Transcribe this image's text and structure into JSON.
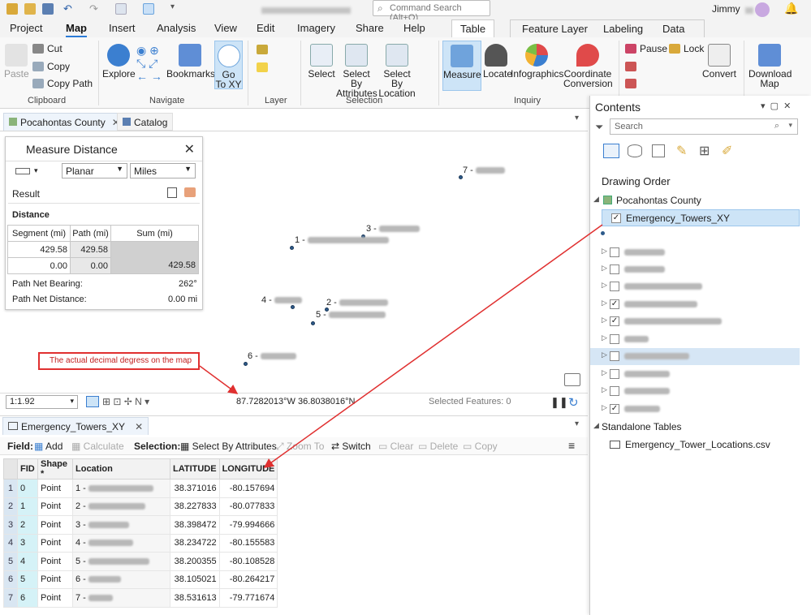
{
  "qat": {
    "search_placeholder": "Command Search (Alt+Q)",
    "user": "Jimmy"
  },
  "tabs": [
    "Project",
    "Map",
    "Insert",
    "Analysis",
    "View",
    "Edit",
    "Imagery",
    "Share",
    "Help"
  ],
  "ctx_tabs": [
    "Table",
    "Feature Layer",
    "Labeling",
    "Data"
  ],
  "ribbon": {
    "paste": "Paste",
    "cut": "Cut",
    "copy": "Copy",
    "copy_path": "Copy Path",
    "clipboard": "Clipboard",
    "explore": "Explore",
    "bookmarks": "Bookmarks",
    "go_to_xy": "Go\nTo XY",
    "navigate": "Navigate",
    "layer": "Layer",
    "select": "Select",
    "select_by_attr": "Select By\nAttributes",
    "select_by_loc": "Select By\nLocation",
    "selection": "Selection",
    "measure": "Measure",
    "locate": "Locate",
    "infographics": "Infographics",
    "coord_conv": "Coordinate\nConversion",
    "inquiry": "Inquiry",
    "pause": "Pause",
    "lock": "Lock",
    "convert": "Convert",
    "download_map": "Download\nMap"
  },
  "doc_tabs": {
    "map": "Pocahontas County",
    "catalog": "Catalog"
  },
  "measure": {
    "title": "Measure Distance",
    "mode": "Planar",
    "units": "Miles",
    "result": "Result",
    "distance": "Distance",
    "headers": [
      "Segment (mi)",
      "Path (mi)",
      "Sum (mi)"
    ],
    "rows": [
      [
        "429.58",
        "429.58",
        ""
      ],
      [
        "0.00",
        "0.00",
        "429.58"
      ]
    ],
    "bearing_label": "Path Net Bearing:",
    "bearing_value": "262°",
    "netdist_label": "Path Net Distance:",
    "netdist_value": "0.00 mi"
  },
  "map_points": [
    {
      "label": "7 -"
    },
    {
      "label": "3 -"
    },
    {
      "label": "1 -"
    },
    {
      "label": "4 -"
    },
    {
      "label": "2 -"
    },
    {
      "label": "5 -"
    },
    {
      "label": "6 -"
    }
  ],
  "annotation": "The actual decimal degress on the map",
  "status": {
    "scale": "1:1.92",
    "coords": "87.7282013°W 36.8038016°N",
    "selected": "Selected Features: 0"
  },
  "table": {
    "tab": "Emergency_Towers_XY",
    "field": "Field:",
    "add": "Add",
    "calculate": "Calculate",
    "selection": "Selection:",
    "sel_by_attr": "Select By Attributes",
    "zoom_to": "Zoom To",
    "switch": "Switch",
    "clear": "Clear",
    "delete": "Delete",
    "copy": "Copy",
    "headers": [
      "FID",
      "Shape *",
      "Location",
      "LATITUDE",
      "LONGITUDE"
    ],
    "rows": [
      [
        "1",
        "0",
        "Point",
        "1 -",
        "38.371016",
        "-80.157694"
      ],
      [
        "2",
        "1",
        "Point",
        "2 -",
        "38.227833",
        "-80.077833"
      ],
      [
        "3",
        "2",
        "Point",
        "3 -",
        "38.398472",
        "-79.994666"
      ],
      [
        "4",
        "3",
        "Point",
        "4 -",
        "38.234722",
        "-80.155583"
      ],
      [
        "5",
        "4",
        "Point",
        "5 -",
        "38.200355",
        "-80.108528"
      ],
      [
        "6",
        "5",
        "Point",
        "6 -",
        "38.105021",
        "-80.264217"
      ],
      [
        "7",
        "6",
        "Point",
        "7 -",
        "38.531613",
        "-79.771674"
      ]
    ]
  },
  "contents": {
    "title": "Contents",
    "search": "Search",
    "drawing_order": "Drawing Order",
    "map": "Pocahontas County",
    "layer": "Emergency_Towers_XY",
    "standalone": "Standalone Tables",
    "standalone_table": "Emergency_Tower_Locations.csv"
  }
}
